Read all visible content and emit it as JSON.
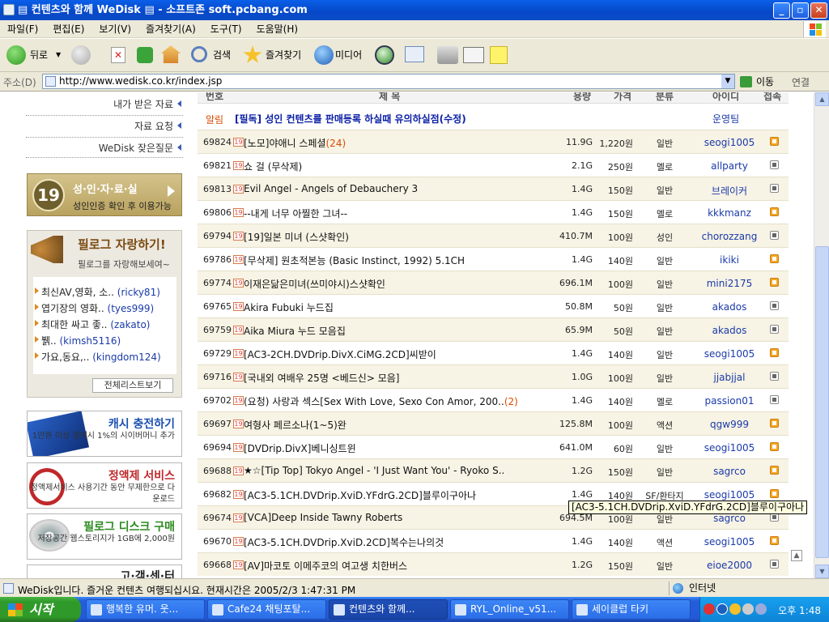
{
  "window": {
    "title": "▤ 컨텐츠와 함께 WeDisk ▤ - 소프트존 soft.pcbang.com",
    "btn_min": "_",
    "btn_max": "▫",
    "btn_close": "✕"
  },
  "menu": [
    "파일(F)",
    "편집(E)",
    "보기(V)",
    "즐겨찾기(A)",
    "도구(T)",
    "도움말(H)"
  ],
  "toolbar": {
    "back": "뒤로",
    "search": "검색",
    "favorites": "즐겨찾기",
    "media": "미디어"
  },
  "address": {
    "label": "주소(D)",
    "url": "http://www.wedisk.co.kr/index.jsp",
    "go": "이동",
    "links": "연결"
  },
  "left": {
    "help_items": [
      "내가 받은 자료",
      "자료 요청",
      "WeDisk 잦은질문"
    ],
    "adult": {
      "badge": "19",
      "title": "성·인·자·료·실",
      "subtitle": "성인인증 확인 후 이용가능"
    },
    "brag": {
      "title": "필로그 자랑하기!",
      "subtitle": "필로그를 자랑해보세여~",
      "items": [
        {
          "text": "최신AV,영화, 소..",
          "user": "(ricky81)"
        },
        {
          "text": "엽기장의 영화..",
          "user": "(tyes999)"
        },
        {
          "text": "최대한 싸고 좋..",
          "user": "(zakato)"
        },
        {
          "text": "뷁..",
          "user": "(kimsh5116)"
        },
        {
          "text": "가요,동요,..",
          "user": "(kingdom124)"
        }
      ],
      "all_button": "전체리스트보기"
    },
    "promos": [
      {
        "title": "캐시 충전하기",
        "desc": "1만원 이상 결제시 1%의 시이버머니 추가",
        "color": "#1a4fb0"
      },
      {
        "title": "정액제 서비스",
        "desc": "정액제서비스 사용기간 동안 무제한으로 다운로드",
        "color": "#c0282a"
      },
      {
        "title": "필로그 디스크 구매",
        "desc": "저장공간 웹스토리지가 1GB에 2,000원",
        "color": "#2b8a1f"
      },
      {
        "title": "고·객·센·터",
        "desc": "",
        "color": "#222"
      }
    ]
  },
  "table": {
    "headers": {
      "no": "번호",
      "title": "제 목",
      "size": "용량",
      "price": "가격",
      "cat": "분류",
      "user": "아이디",
      "conn": "접속"
    },
    "notice": {
      "tag": "알림",
      "title": "[필독] 성인 컨텐츠를 판매등록 하실때 유의하실점(수정)",
      "user": "운영팀"
    },
    "badge19": "19",
    "rows": [
      {
        "no": "69824",
        "title": "[노모]야애니 스페셜",
        "comments": "(24)",
        "size": "11.9G",
        "price": "1,220원",
        "cat": "일반",
        "user": "seogi1005",
        "on": true
      },
      {
        "no": "69821",
        "title": "쇼 걸 (무삭제)",
        "comments": "",
        "size": "2.1G",
        "price": "250원",
        "cat": "멜로",
        "user": "allparty",
        "on": false
      },
      {
        "no": "69813",
        "title": "Evil Angel - Angels of Debauchery 3",
        "comments": "",
        "size": "1.4G",
        "price": "150원",
        "cat": "일반",
        "user": "브레이커",
        "on": false
      },
      {
        "no": "69806",
        "title": "--내게 너무 아찔한 그녀--",
        "comments": "",
        "size": "1.4G",
        "price": "150원",
        "cat": "멜로",
        "user": "kkkmanz",
        "on": true
      },
      {
        "no": "69794",
        "title": "[19]일본 미녀 (스샷확인)",
        "comments": "",
        "size": "410.7M",
        "price": "100원",
        "cat": "성인",
        "user": "chorozzang",
        "on": false
      },
      {
        "no": "69786",
        "title": "[무삭제] 원초적본능 (Basic Instinct, 1992) 5.1CH",
        "comments": "",
        "size": "1.4G",
        "price": "140원",
        "cat": "일반",
        "user": "ikiki",
        "on": true
      },
      {
        "no": "69774",
        "title": "이재은닮은미녀(쓰미야시)스샷확인",
        "comments": "",
        "size": "696.1M",
        "price": "100원",
        "cat": "일반",
        "user": "mini2175",
        "on": true
      },
      {
        "no": "69765",
        "title": "Akira Fubuki 누드집",
        "comments": "",
        "size": "50.8M",
        "price": "50원",
        "cat": "일반",
        "user": "akados",
        "on": false
      },
      {
        "no": "69759",
        "title": "Aika Miura 누드 모음집",
        "comments": "",
        "size": "65.9M",
        "price": "50원",
        "cat": "일반",
        "user": "akados",
        "on": false
      },
      {
        "no": "69729",
        "title": "[AC3-2CH.DVDrip.DivX.CiMG.2CD]씨받이",
        "comments": "",
        "size": "1.4G",
        "price": "140원",
        "cat": "일반",
        "user": "seogi1005",
        "on": true
      },
      {
        "no": "69716",
        "title": "[국내외 여배우 25명 <베드신> 모음]",
        "comments": "",
        "size": "1.0G",
        "price": "100원",
        "cat": "일반",
        "user": "jjabjjal",
        "on": false
      },
      {
        "no": "69702",
        "title": "(요청) 사랑과 섹스[Sex With Love, Sexo Con Amor, 200..",
        "comments": "(2)",
        "size": "1.4G",
        "price": "140원",
        "cat": "멜로",
        "user": "passion01",
        "on": false
      },
      {
        "no": "69697",
        "title": "여형사 페르소나(1~5)완",
        "comments": "",
        "size": "125.8M",
        "price": "100원",
        "cat": "액션",
        "user": "qgw999",
        "on": true
      },
      {
        "no": "69694",
        "title": "[DVDrip.DivX]베니싱트윈",
        "comments": "",
        "size": "641.0M",
        "price": "60원",
        "cat": "일반",
        "user": "seogi1005",
        "on": true
      },
      {
        "no": "69688",
        "title": "★☆[Tip Top] Tokyo Angel - 'I Just Want You' - Ryoko S..",
        "comments": "",
        "size": "1.2G",
        "price": "150원",
        "cat": "일반",
        "user": "sagrco",
        "on": true
      },
      {
        "no": "69682",
        "title": "[AC3-5.1CH.DVDrip.XviD.YFdrG.2CD]블루이구아나",
        "comments": "",
        "size": "1.4G",
        "price": "140원",
        "cat": "SF/환타지",
        "user": "seogi1005",
        "on": true
      },
      {
        "no": "69674",
        "title": "[VCA]Deep Inside Tawny Roberts",
        "comments": "",
        "size": "694.5M",
        "price": "100원",
        "cat": "일반",
        "user": "sagrco",
        "on": false
      },
      {
        "no": "69670",
        "title": "[AC3-5.1CH.DVDrip.XviD.2CD]복수는나의것",
        "comments": "",
        "size": "1.4G",
        "price": "140원",
        "cat": "액션",
        "user": "seogi1005",
        "on": true
      },
      {
        "no": "69668",
        "title": "[AV]마코토 이메주코의 여고생 치한버스",
        "comments": "",
        "size": "1.2G",
        "price": "150원",
        "cat": "일반",
        "user": "eioe2000",
        "on": false
      }
    ],
    "tooltip": "[AC3-5.1CH.DVDrip.XviD.YFdrG.2CD]블루이구아나"
  },
  "status": {
    "text": "WeDisk입니다. 즐거운 컨텐츠 여행되십시요. 현재시간은 2005/2/3 1:47:31 PM",
    "zone": "인터넷"
  },
  "taskbar": {
    "start": "시작",
    "tasks": [
      "행복한 유머. 웃...",
      "Cafe24 채팅포탈...",
      "컨텐츠와 함께...",
      "RYL_Online_v51...",
      "세이클럽 타키"
    ],
    "clock": "오후 1:48"
  }
}
